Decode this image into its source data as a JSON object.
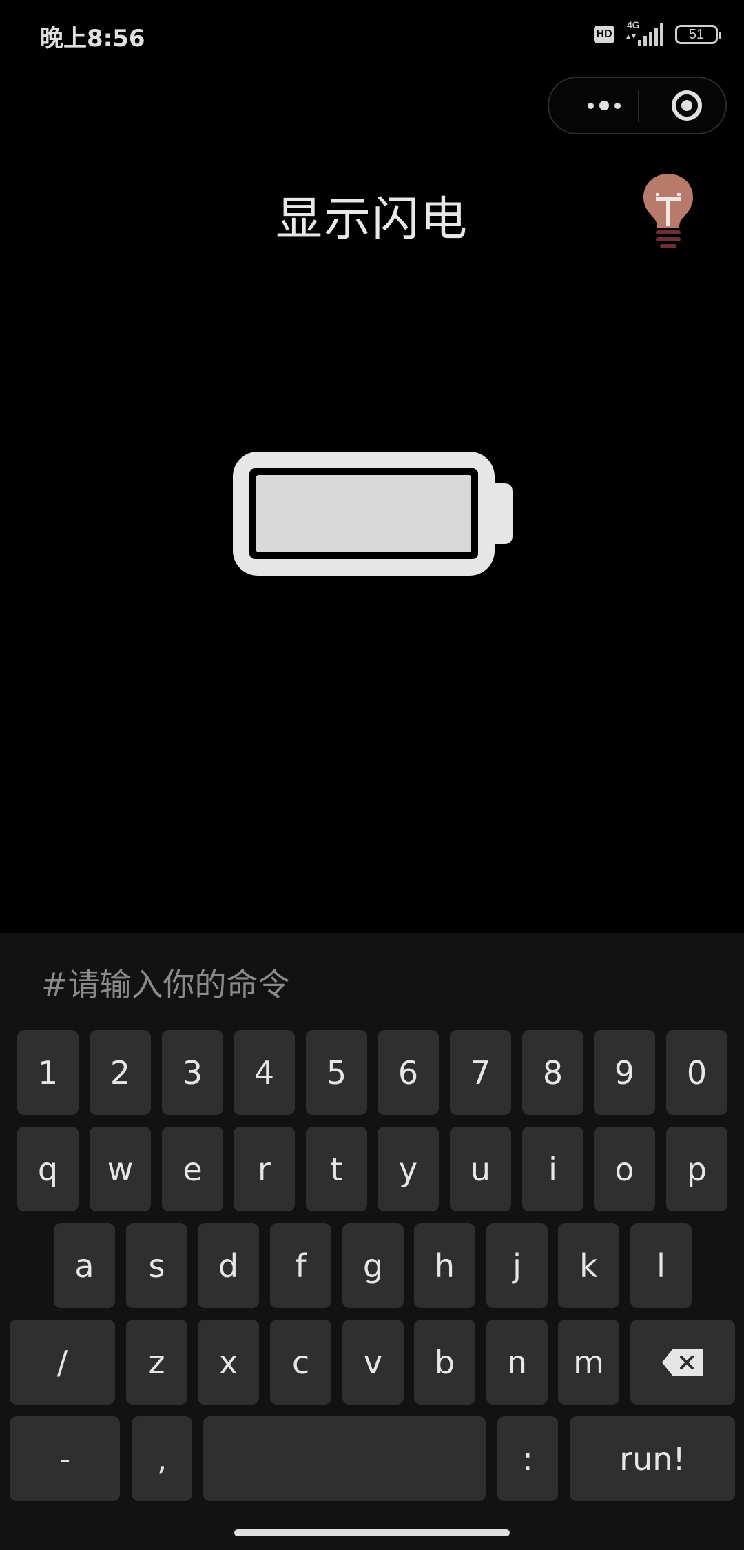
{
  "status_bar": {
    "time": "晚上8:56",
    "hd_badge": "HD",
    "network_type": "4G",
    "battery_level": "51"
  },
  "page": {
    "title": "显示闪电"
  },
  "icons": {
    "more": "more-dots-icon",
    "close": "target-close-icon",
    "hint": "lightbulb-icon",
    "battery_display": "battery-icon",
    "backspace": "backspace-icon"
  },
  "colors": {
    "background": "#000000",
    "keyboard_background": "#121212",
    "key_background": "#2f2f2f",
    "text": "#e6e6e6",
    "bulb": "#b87a6b",
    "bulb_base": "#6e2e36",
    "battery_fill": "#d9d9d9"
  },
  "command": {
    "placeholder": "#请输入你的命令",
    "value": ""
  },
  "keyboard": {
    "number_row": [
      "1",
      "2",
      "3",
      "4",
      "5",
      "6",
      "7",
      "8",
      "9",
      "0"
    ],
    "row_q": [
      "q",
      "w",
      "e",
      "r",
      "t",
      "y",
      "u",
      "i",
      "o",
      "p"
    ],
    "row_a": [
      "a",
      "s",
      "d",
      "f",
      "g",
      "h",
      "j",
      "k",
      "l"
    ],
    "row_z": {
      "slash": "/",
      "letters": [
        "z",
        "x",
        "c",
        "v",
        "b",
        "n",
        "m"
      ]
    },
    "bottom_row": {
      "dash": "-",
      "comma": ",",
      "space": "",
      "colon": ":",
      "run": "run!"
    }
  }
}
